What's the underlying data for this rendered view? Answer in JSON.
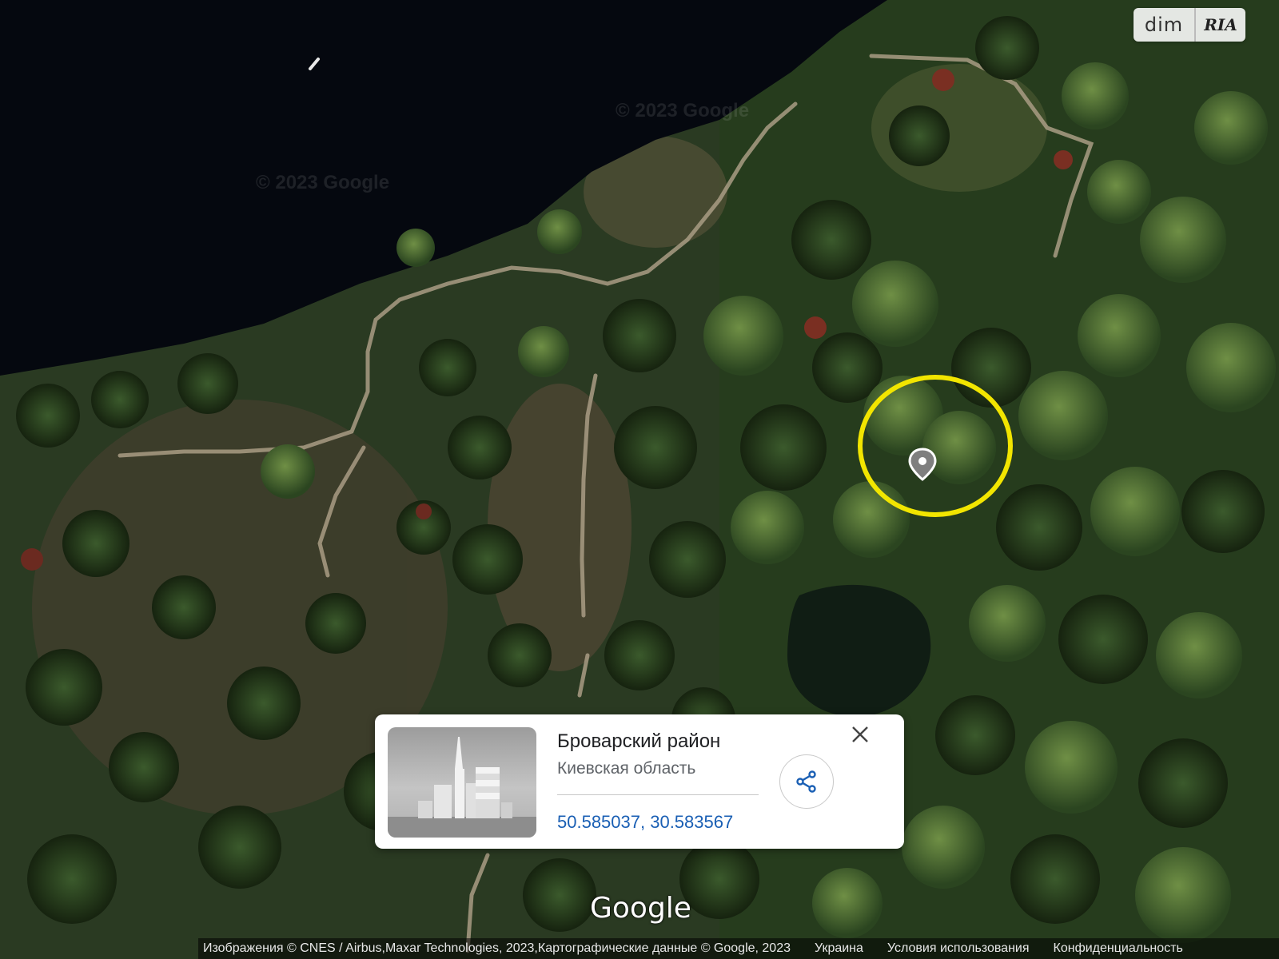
{
  "watermark": {
    "left": "dim",
    "right": "RIA"
  },
  "map": {
    "copyright_faint_1": "© 2023 Google",
    "copyright_faint_2": "© 2023 Google",
    "marker": {
      "ring_color": "#f2e500",
      "pin_icon": "location-pin-icon"
    }
  },
  "info_card": {
    "title": "Броварский район",
    "subtitle": "Киевская область",
    "coordinates": "50.585037, 30.583567",
    "share_icon": "share-icon",
    "close_icon": "close-icon",
    "thumbnail_icon": "city-buildings-icon"
  },
  "google_logo": "Google",
  "footer": {
    "attribution": "Изображения © CNES / Airbus,Maxar Technologies, 2023,Картографические данные © Google, 2023",
    "country_link": "Украина",
    "terms_link": "Условия использования",
    "privacy_link": "Конфиденциальность"
  },
  "colors": {
    "water": "#05080f",
    "forest": "#1f3018",
    "path": "#a99c84",
    "marker_ring": "#f2e500",
    "link": "#1a5fb4"
  }
}
